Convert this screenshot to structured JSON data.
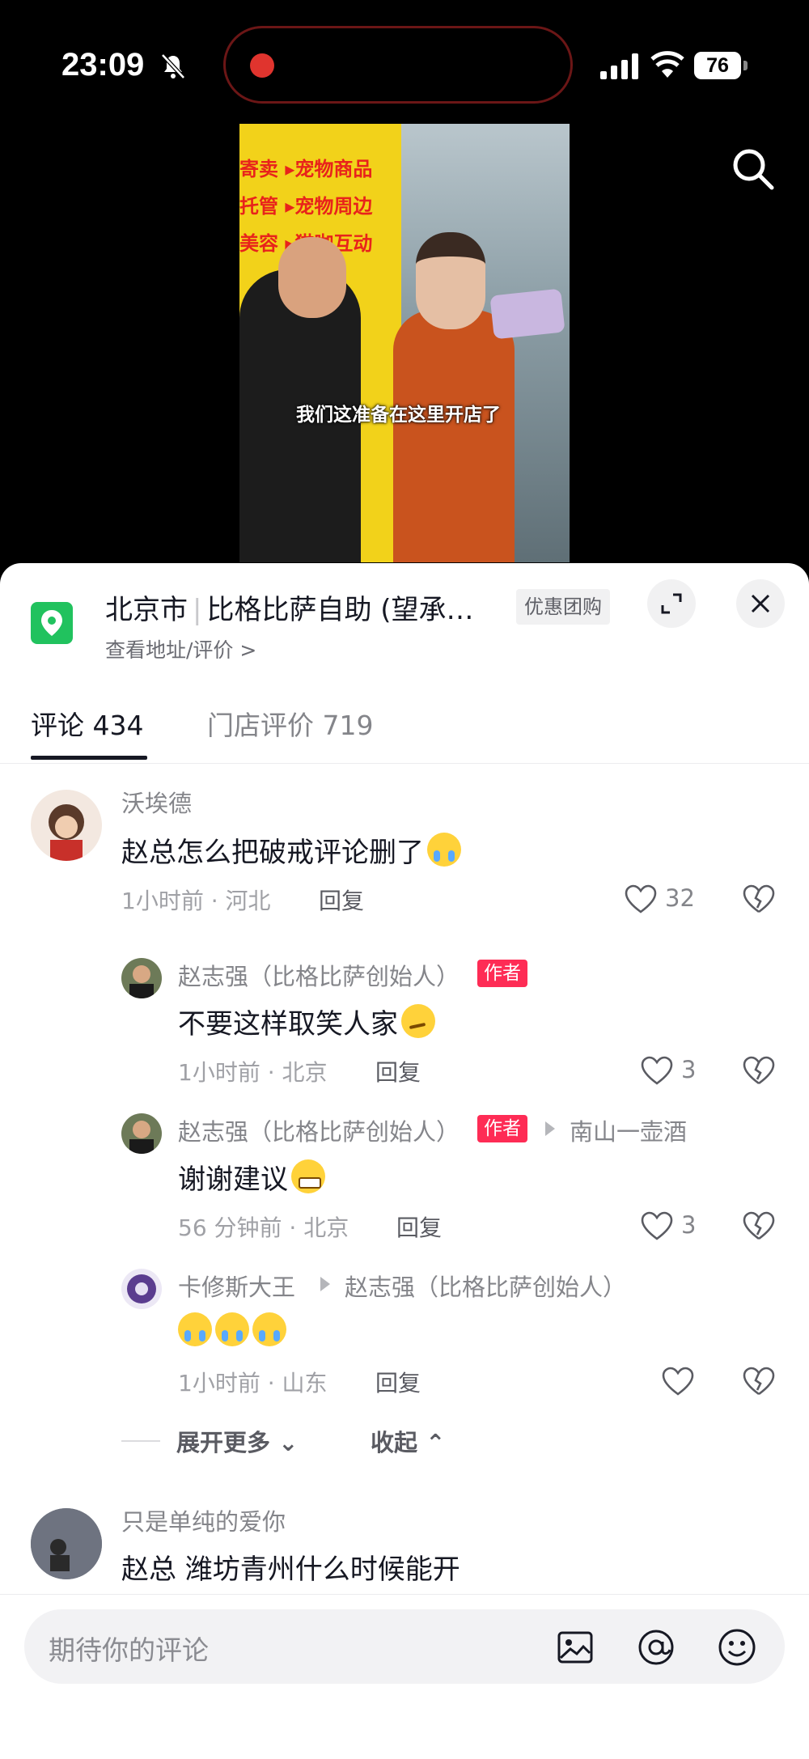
{
  "status_bar": {
    "time": "23:09",
    "battery": "76"
  },
  "video": {
    "sign_lines": [
      "寄卖 ▸宠物商品",
      "托管 ▸宠物周边",
      "美容 ▸猫咖互动"
    ],
    "subtitle": "我们这准备在这里开店了"
  },
  "location": {
    "city": "北京市",
    "store": "比格比萨自助 (望承…",
    "deal_badge": "优惠团购",
    "sub_link": "查看地址/评价 >"
  },
  "tabs": [
    {
      "label": "评论 434"
    },
    {
      "label": "门店评价 719"
    }
  ],
  "comments": [
    {
      "user": "沃埃德",
      "text": "赵总怎么把破戒评论删了",
      "meta": "1小时前 · 河北",
      "reply": "回复",
      "likes": "32"
    },
    {
      "user": "赵志强（比格比萨创始人）",
      "badge": "作者",
      "text": "不要这样取笑人家",
      "meta": "1小时前 · 北京",
      "reply": "回复",
      "likes": "3"
    },
    {
      "user": "赵志强（比格比萨创始人）",
      "badge": "作者",
      "reply_to": "南山一壶酒",
      "text": "谢谢建议",
      "meta": "56 分钟前 · 北京",
      "reply": "回复",
      "likes": "3"
    },
    {
      "user": "卡修斯大王",
      "reply_to": "赵志强（比格比萨创始人）",
      "text": "",
      "meta": "1小时前 · 山东",
      "reply": "回复",
      "likes": ""
    },
    {
      "user": "只是单纯的爱你",
      "text": "赵总 潍坊青州什么时候能开"
    }
  ],
  "thread_controls": {
    "expand_more": "展开更多",
    "collapse": "收起"
  },
  "input": {
    "placeholder": "期待你的评论"
  },
  "colors": {
    "accent": "#fe2c55",
    "location_pin": "#21c25e"
  },
  "icons": [
    "bell-slash-icon",
    "signal-icon",
    "wifi-icon",
    "battery-icon",
    "search-icon",
    "location-pin-icon",
    "expand-icon",
    "close-icon",
    "heart-icon",
    "broken-heart-icon",
    "chevron-down-icon",
    "chevron-up-icon",
    "image-icon",
    "at-icon",
    "emoji-icon"
  ]
}
